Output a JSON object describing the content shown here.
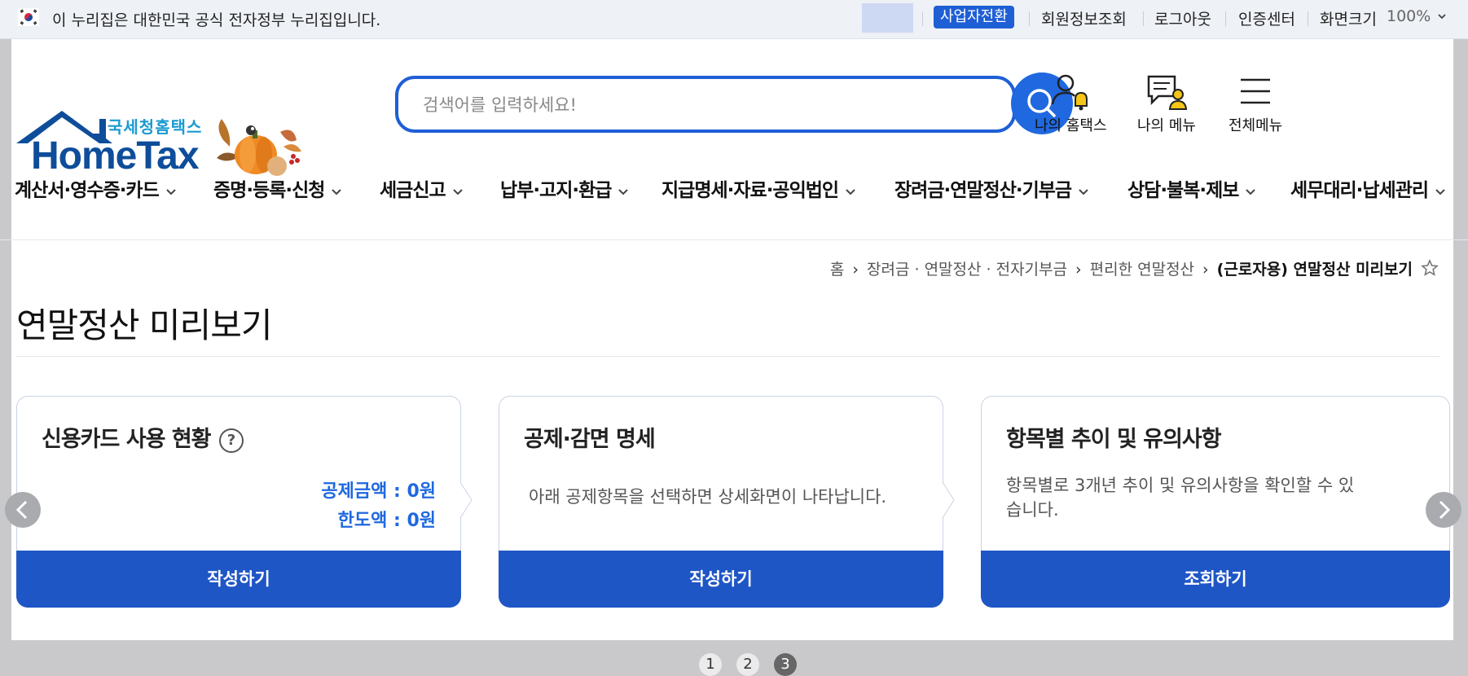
{
  "gov_bar": {
    "text": "이 누리집은 대한민국 공식 전자정부 누리집입니다.",
    "switch_button": "사업자전환",
    "links": [
      "회원정보조회",
      "로그아웃",
      "인증센터"
    ],
    "zoom_label": "화면크기",
    "zoom_value": "100%"
  },
  "logo": {
    "sub": "국세청홈택스",
    "main": "HomeTax"
  },
  "search": {
    "placeholder": "검색어를 입력하세요!"
  },
  "header_menu": {
    "my_hometax": "나의 홈택스",
    "my_menu": "나의 메뉴",
    "all_menu": "전체메뉴"
  },
  "main_nav": [
    "계산서·영수증·카드",
    "증명·등록·신청",
    "세금신고",
    "납부·고지·환급",
    "지급명세·자료·공익법인",
    "장려금·연말정산·기부금",
    "상담·불복·제보",
    "세무대리·납세관리"
  ],
  "breadcrumb": {
    "home": "홈",
    "level1": "장려금 · 연말정산 · 전자기부금",
    "level2": "편리한 연말정산",
    "current": "(근로자용) 연말정산 미리보기"
  },
  "page_title": "연말정산 미리보기",
  "cards": [
    {
      "title": "신용카드 사용 현황",
      "help": "?",
      "deduction_amount": "공제금액 : 0원",
      "limit_amount": "한도액 : 0원",
      "button": "작성하기"
    },
    {
      "title": "공제·감면 명세",
      "description": "아래 공제항목을 선택하면 상세화면이 나타납니다.",
      "button": "작성하기"
    },
    {
      "title": "항목별 추이 및 유의사항",
      "description": "항목별로 3개년 추이 및 유의사항을 확인할 수 있습니다.",
      "button": "조회하기"
    }
  ],
  "pager": [
    "1",
    "2",
    "3"
  ],
  "pager_active": "3",
  "colors": {
    "primary": "#1f5fd6",
    "card_button": "#1f56c6",
    "amount": "#1f68e0",
    "logo_blue": "#0e4d9a",
    "logo_sub": "#1b9ad1"
  },
  "icons": [
    "korea-flag-icon",
    "search-icon",
    "user-bell-icon",
    "menu-person-icon",
    "hamburger-icon",
    "chevron-down-icon",
    "star-icon",
    "help-icon",
    "arrow-left-icon",
    "arrow-right-icon"
  ]
}
